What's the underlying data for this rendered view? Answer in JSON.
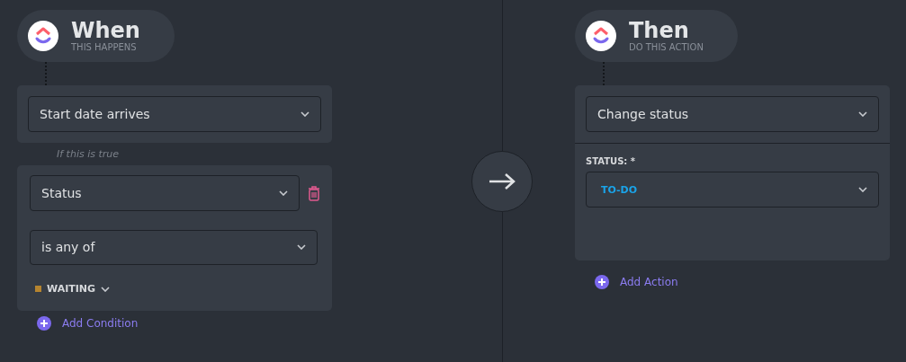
{
  "trigger": {
    "title": "When",
    "subtitle": "THIS HAPPENS",
    "event": "Start date arrives",
    "condition_hint": "If this is true",
    "condition": {
      "field": "Status",
      "operator": "is any of",
      "values": [
        {
          "label": "WAITING",
          "color": "#b5842f"
        }
      ]
    },
    "add_label": "Add Condition"
  },
  "action": {
    "title": "Then",
    "subtitle": "DO THIS ACTION",
    "type": "Change status",
    "field_label": "STATUS: *",
    "value": "TO-DO",
    "add_label": "Add Action"
  }
}
